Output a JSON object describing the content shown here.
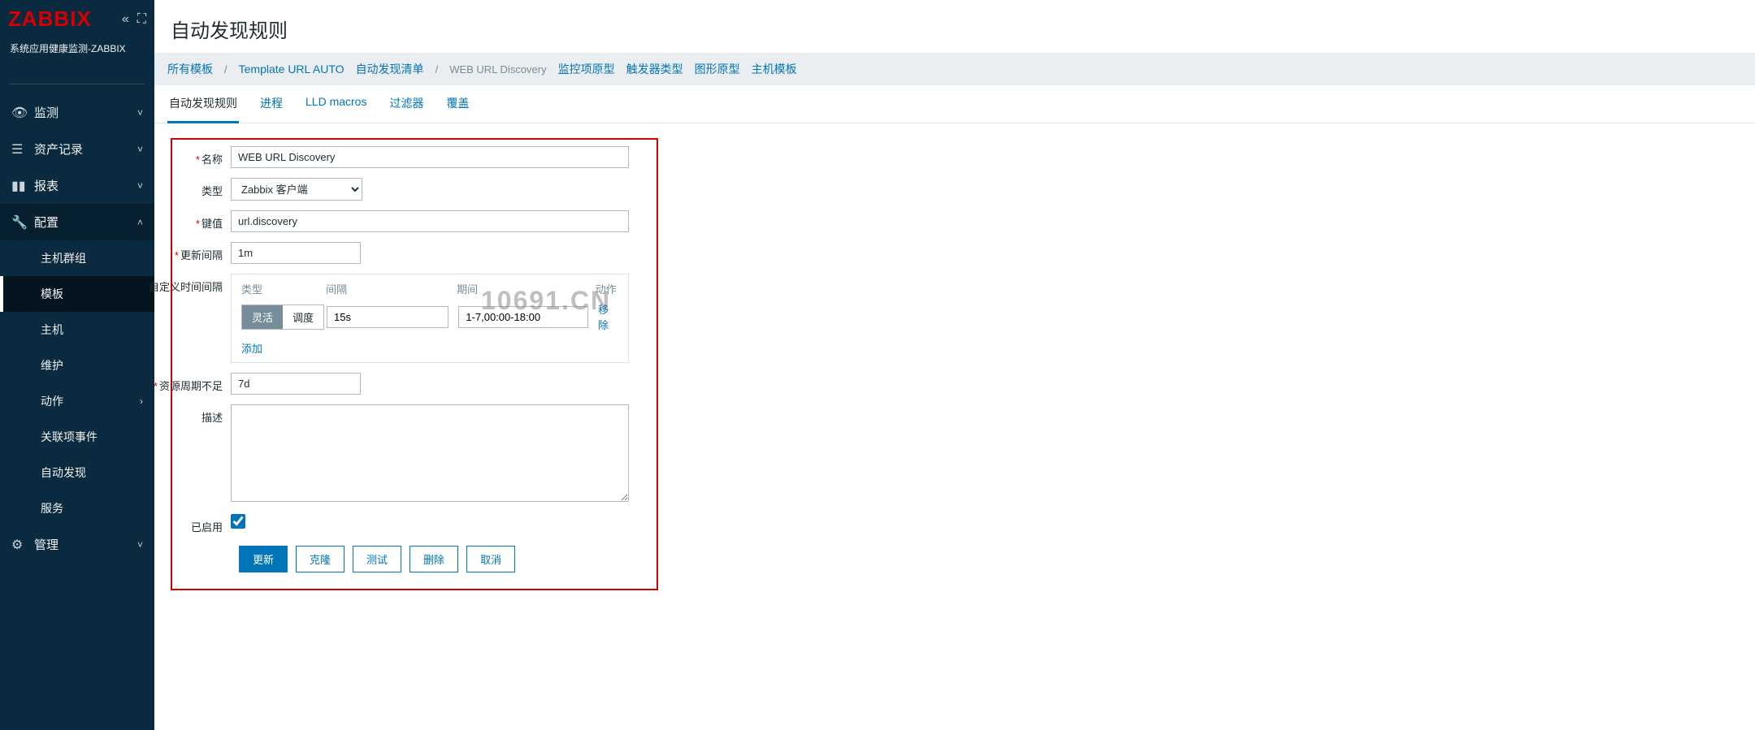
{
  "logo": "ZABBIX",
  "subtitle": "系统应用健康监测-ZABBIX",
  "sidebar": {
    "items": [
      {
        "icon": "👁",
        "label": "监测",
        "chev": "˅"
      },
      {
        "icon": "☰",
        "label": "资产记录",
        "chev": "˅"
      },
      {
        "icon": "▮",
        "label": "报表",
        "chev": "˅"
      },
      {
        "icon": "🔧",
        "label": "配置",
        "chev": "˄"
      },
      {
        "icon": "⚙",
        "label": "管理",
        "chev": "˅"
      }
    ],
    "config_sub": [
      "主机群组",
      "模板",
      "主机",
      "维护",
      "动作",
      "关联项事件",
      "自动发现",
      "服务"
    ]
  },
  "page_title": "自动发现规则",
  "breadcrumb": {
    "all_templates": "所有模板",
    "template_name": "Template URL AUTO",
    "discovery_list": "自动发现清单",
    "current": "WEB URL Discovery",
    "links": [
      "监控项原型",
      "触发器类型",
      "图形原型",
      "主机模板"
    ]
  },
  "tabs": [
    "自动发现规则",
    "进程",
    "LLD macros",
    "过滤器",
    "覆盖"
  ],
  "form": {
    "labels": {
      "name": "名称",
      "type": "类型",
      "key": "键值",
      "interval": "更新间隔",
      "custom_interval": "自定义时间间隔",
      "keep_lost": "资源周期不足",
      "description": "描述",
      "enabled": "已启用"
    },
    "name": "WEB URL Discovery",
    "type": "Zabbix 客户端",
    "key": "url.discovery",
    "interval": "1m",
    "custom": {
      "head_type": "类型",
      "head_interval": "间隔",
      "head_period": "期间",
      "head_action": "动作",
      "seg_flex": "灵活",
      "seg_sched": "调度",
      "intv": "15s",
      "period": "1-7,00:00-18:00",
      "remove": "移除",
      "add": "添加"
    },
    "keep_lost": "7d",
    "enabled": true
  },
  "buttons": {
    "update": "更新",
    "clone": "克隆",
    "test": "测试",
    "delete": "删除",
    "cancel": "取消"
  },
  "watermark": "10691.CN"
}
